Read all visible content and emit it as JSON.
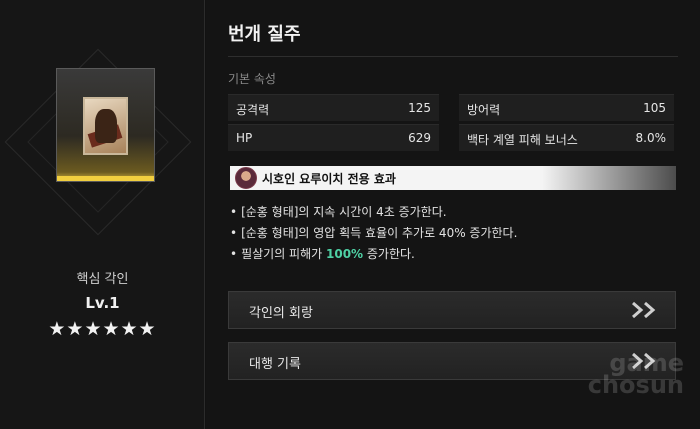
{
  "card": {
    "core_label": "핵심 각인",
    "level": "Lv.1",
    "stars": "★★★★★★"
  },
  "detail": {
    "title": "번개 질주",
    "section_label": "기본 속성",
    "stats": [
      {
        "name": "공격력",
        "value": "125"
      },
      {
        "name": "방어력",
        "value": "105"
      },
      {
        "name": "HP",
        "value": "629"
      },
      {
        "name": "백타 계열 피해 보너스",
        "value": "8.0%"
      }
    ],
    "exclusive_label": "시호인 요루이치 전용 효과",
    "effects": [
      {
        "bullet": "•",
        "text": "[순홍 형태]의 지속 시간이 4초 증가한다."
      },
      {
        "bullet": "•",
        "text": "[순홍 형태]의 영압 획득 효율이 추가로 40% 증가한다."
      },
      {
        "bullet": "•",
        "pre": "필살기의 피해가 ",
        "highlight": "100%",
        "post": " 증가한다."
      }
    ],
    "buttons": [
      {
        "label": "각인의 회랑",
        "icon": "double-chevron-right-icon"
      },
      {
        "label": "대행 기록",
        "icon": "double-chevron-right-icon"
      }
    ],
    "highlight_color": "#4fd1a5"
  },
  "watermark": {
    "line1": "game",
    "line2": "chosun"
  }
}
